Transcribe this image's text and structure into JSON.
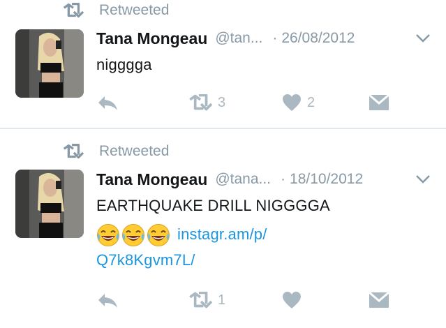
{
  "colors": {
    "muted": "#8899a6",
    "icon": "#aab8c2",
    "link": "#1b95e0",
    "text": "#14171a"
  },
  "tweets": [
    {
      "retweet_label": "Retweeted",
      "name": "Tana Mongeau",
      "handle": "@tan...",
      "date_sep": "·",
      "date": "26/08/2012",
      "text": "nigggga",
      "actions": {
        "reply_icon": "reply-icon",
        "retweet_icon": "retweet-icon",
        "retweet_count": "3",
        "like_icon": "heart-icon",
        "like_count": "2",
        "dm_icon": "envelope-icon"
      }
    },
    {
      "retweet_label": "Retweeted",
      "name": "Tana Mongeau",
      "handle": "@tana...",
      "date_sep": "·",
      "date": "18/10/2012",
      "text": "EARTHQUAKE DRILL NIGGGGA",
      "emojis": [
        "😂",
        "😂",
        "😂"
      ],
      "link_line1": "instagr.am/p/",
      "link_line2": "Q7k8Kgvm7L/",
      "actions": {
        "reply_icon": "reply-icon",
        "retweet_icon": "retweet-icon",
        "retweet_count": "1",
        "like_icon": "heart-icon",
        "like_count": "",
        "dm_icon": "envelope-icon"
      }
    }
  ]
}
